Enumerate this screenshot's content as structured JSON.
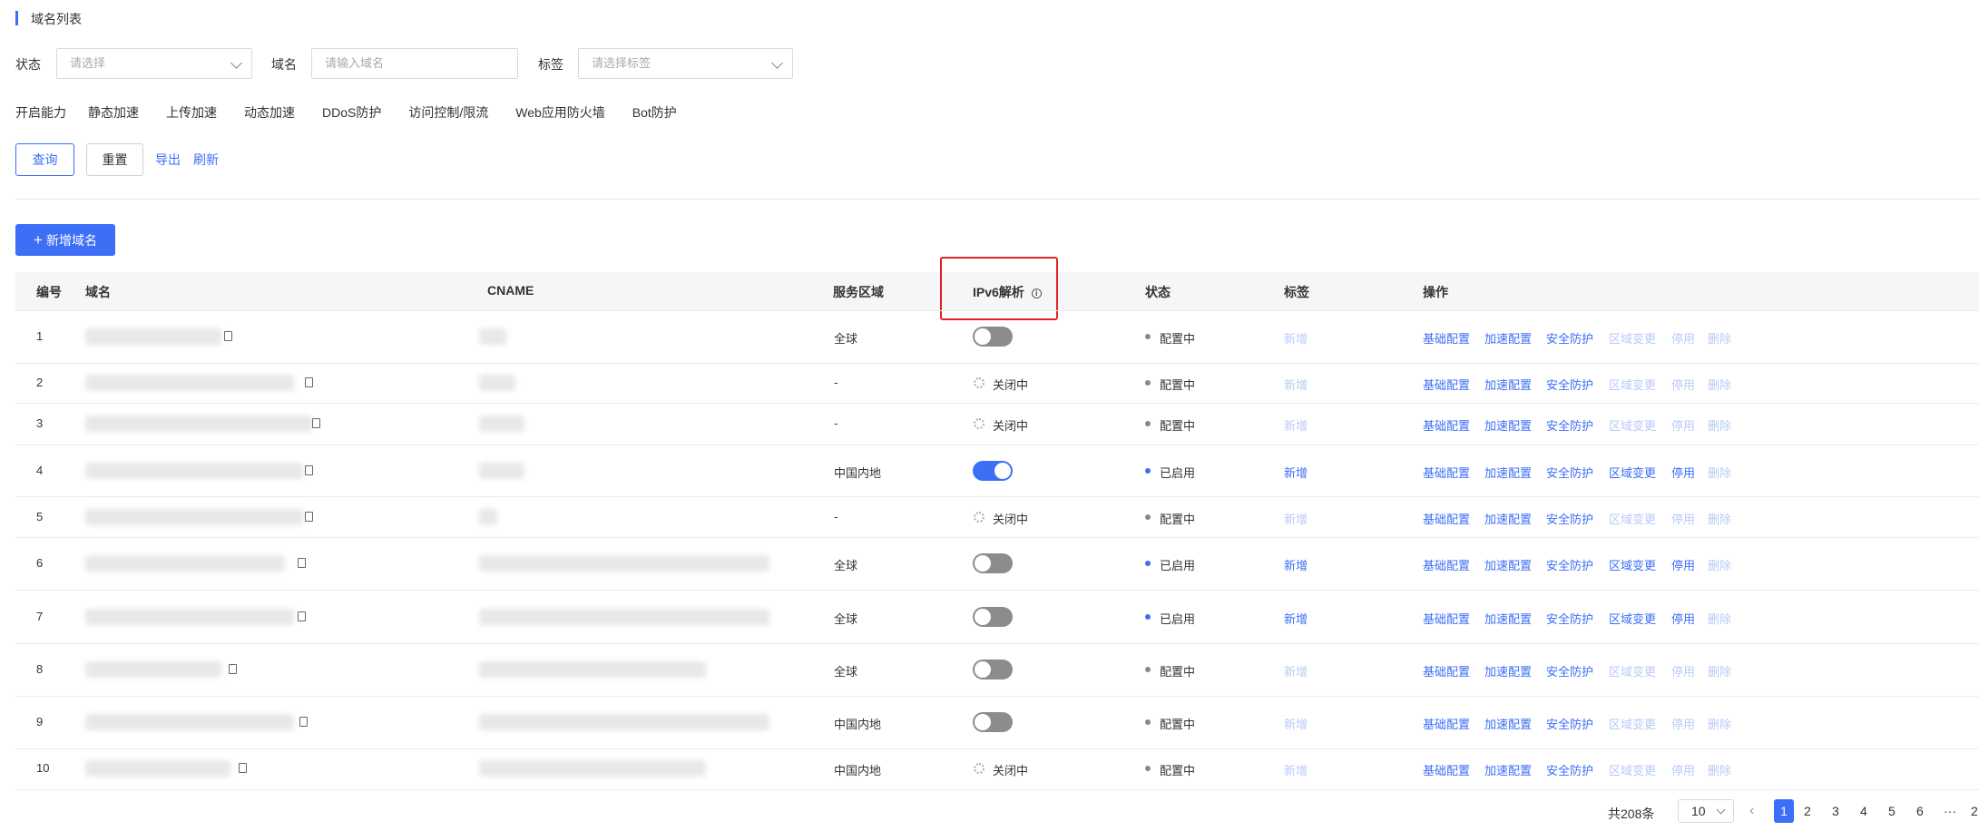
{
  "page": {
    "section_title": "域名列表"
  },
  "filters": {
    "status_label": "状态",
    "status_placeholder": "请选择",
    "domain_label": "域名",
    "domain_placeholder": "请输入域名",
    "tag_label": "标签",
    "tag_placeholder": "请选择标签",
    "capability_label": "开启能力",
    "capabilities": [
      "静态加速",
      "上传加速",
      "动态加速",
      "DDoS防护",
      "访问控制/限流",
      "Web应用防火墙",
      "Bot防护"
    ]
  },
  "actions": {
    "query": "查询",
    "reset": "重置",
    "export": "导出",
    "refresh": "刷新",
    "add_domain": "新增域名",
    "add_icon": "plus-icon"
  },
  "table": {
    "headers": {
      "no": "编号",
      "domain": "域名",
      "cname": "CNAME",
      "region": "服务区域",
      "ipv6": "IPv6解析",
      "status": "状态",
      "tag": "标签",
      "ops": "操作"
    },
    "rows": [
      {
        "no": "1",
        "region": "全球",
        "ipv6": "toggle-off",
        "ipv6_text": "",
        "status": "配置中",
        "tag": "新增",
        "tag_enabled": false,
        "ops_enabled": [
          true,
          true,
          true,
          false,
          false,
          false
        ]
      },
      {
        "no": "2",
        "region": "-",
        "ipv6": "closing",
        "ipv6_text": "关闭中",
        "status": "配置中",
        "tag": "新增",
        "tag_enabled": false,
        "ops_enabled": [
          true,
          true,
          true,
          false,
          false,
          false
        ]
      },
      {
        "no": "3",
        "region": "-",
        "ipv6": "closing",
        "ipv6_text": "关闭中",
        "status": "配置中",
        "tag": "新增",
        "tag_enabled": false,
        "ops_enabled": [
          true,
          true,
          true,
          false,
          false,
          false
        ]
      },
      {
        "no": "4",
        "region": "中国内地",
        "ipv6": "toggle-on",
        "ipv6_text": "",
        "status": "已启用",
        "tag": "新增",
        "tag_enabled": true,
        "ops_enabled": [
          true,
          true,
          true,
          true,
          true,
          false
        ]
      },
      {
        "no": "5",
        "region": "-",
        "ipv6": "closing",
        "ipv6_text": "关闭中",
        "status": "配置中",
        "tag": "新增",
        "tag_enabled": false,
        "ops_enabled": [
          true,
          true,
          true,
          false,
          false,
          false
        ]
      },
      {
        "no": "6",
        "region": "全球",
        "ipv6": "toggle-off",
        "ipv6_text": "",
        "status": "已启用",
        "tag": "新增",
        "tag_enabled": true,
        "ops_enabled": [
          true,
          true,
          true,
          true,
          true,
          false
        ]
      },
      {
        "no": "7",
        "region": "全球",
        "ipv6": "toggle-off",
        "ipv6_text": "",
        "status": "已启用",
        "tag": "新增",
        "tag_enabled": true,
        "ops_enabled": [
          true,
          true,
          true,
          true,
          true,
          false
        ]
      },
      {
        "no": "8",
        "region": "全球",
        "ipv6": "toggle-off",
        "ipv6_text": "",
        "status": "配置中",
        "tag": "新增",
        "tag_enabled": false,
        "ops_enabled": [
          true,
          true,
          true,
          false,
          false,
          false
        ]
      },
      {
        "no": "9",
        "region": "中国内地",
        "ipv6": "toggle-off",
        "ipv6_text": "",
        "status": "配置中",
        "tag": "新增",
        "tag_enabled": false,
        "ops_enabled": [
          true,
          true,
          true,
          false,
          false,
          false
        ]
      },
      {
        "no": "10",
        "region": "中国内地",
        "ipv6": "closing",
        "ipv6_text": "关闭中",
        "status": "配置中",
        "tag": "新增",
        "tag_enabled": false,
        "ops_enabled": [
          true,
          true,
          true,
          false,
          false,
          false
        ]
      }
    ],
    "op_labels": [
      "基础配置",
      "加速配置",
      "安全防护",
      "区域变更",
      "停用",
      "删除"
    ]
  },
  "pagination": {
    "total": "共208条",
    "page_size": "10",
    "pages": [
      "1",
      "2",
      "3",
      "4",
      "5",
      "6",
      "···",
      "2"
    ],
    "current": "1"
  },
  "colors": {
    "accent": "#3c6ef6",
    "highlight": "#e52222"
  }
}
